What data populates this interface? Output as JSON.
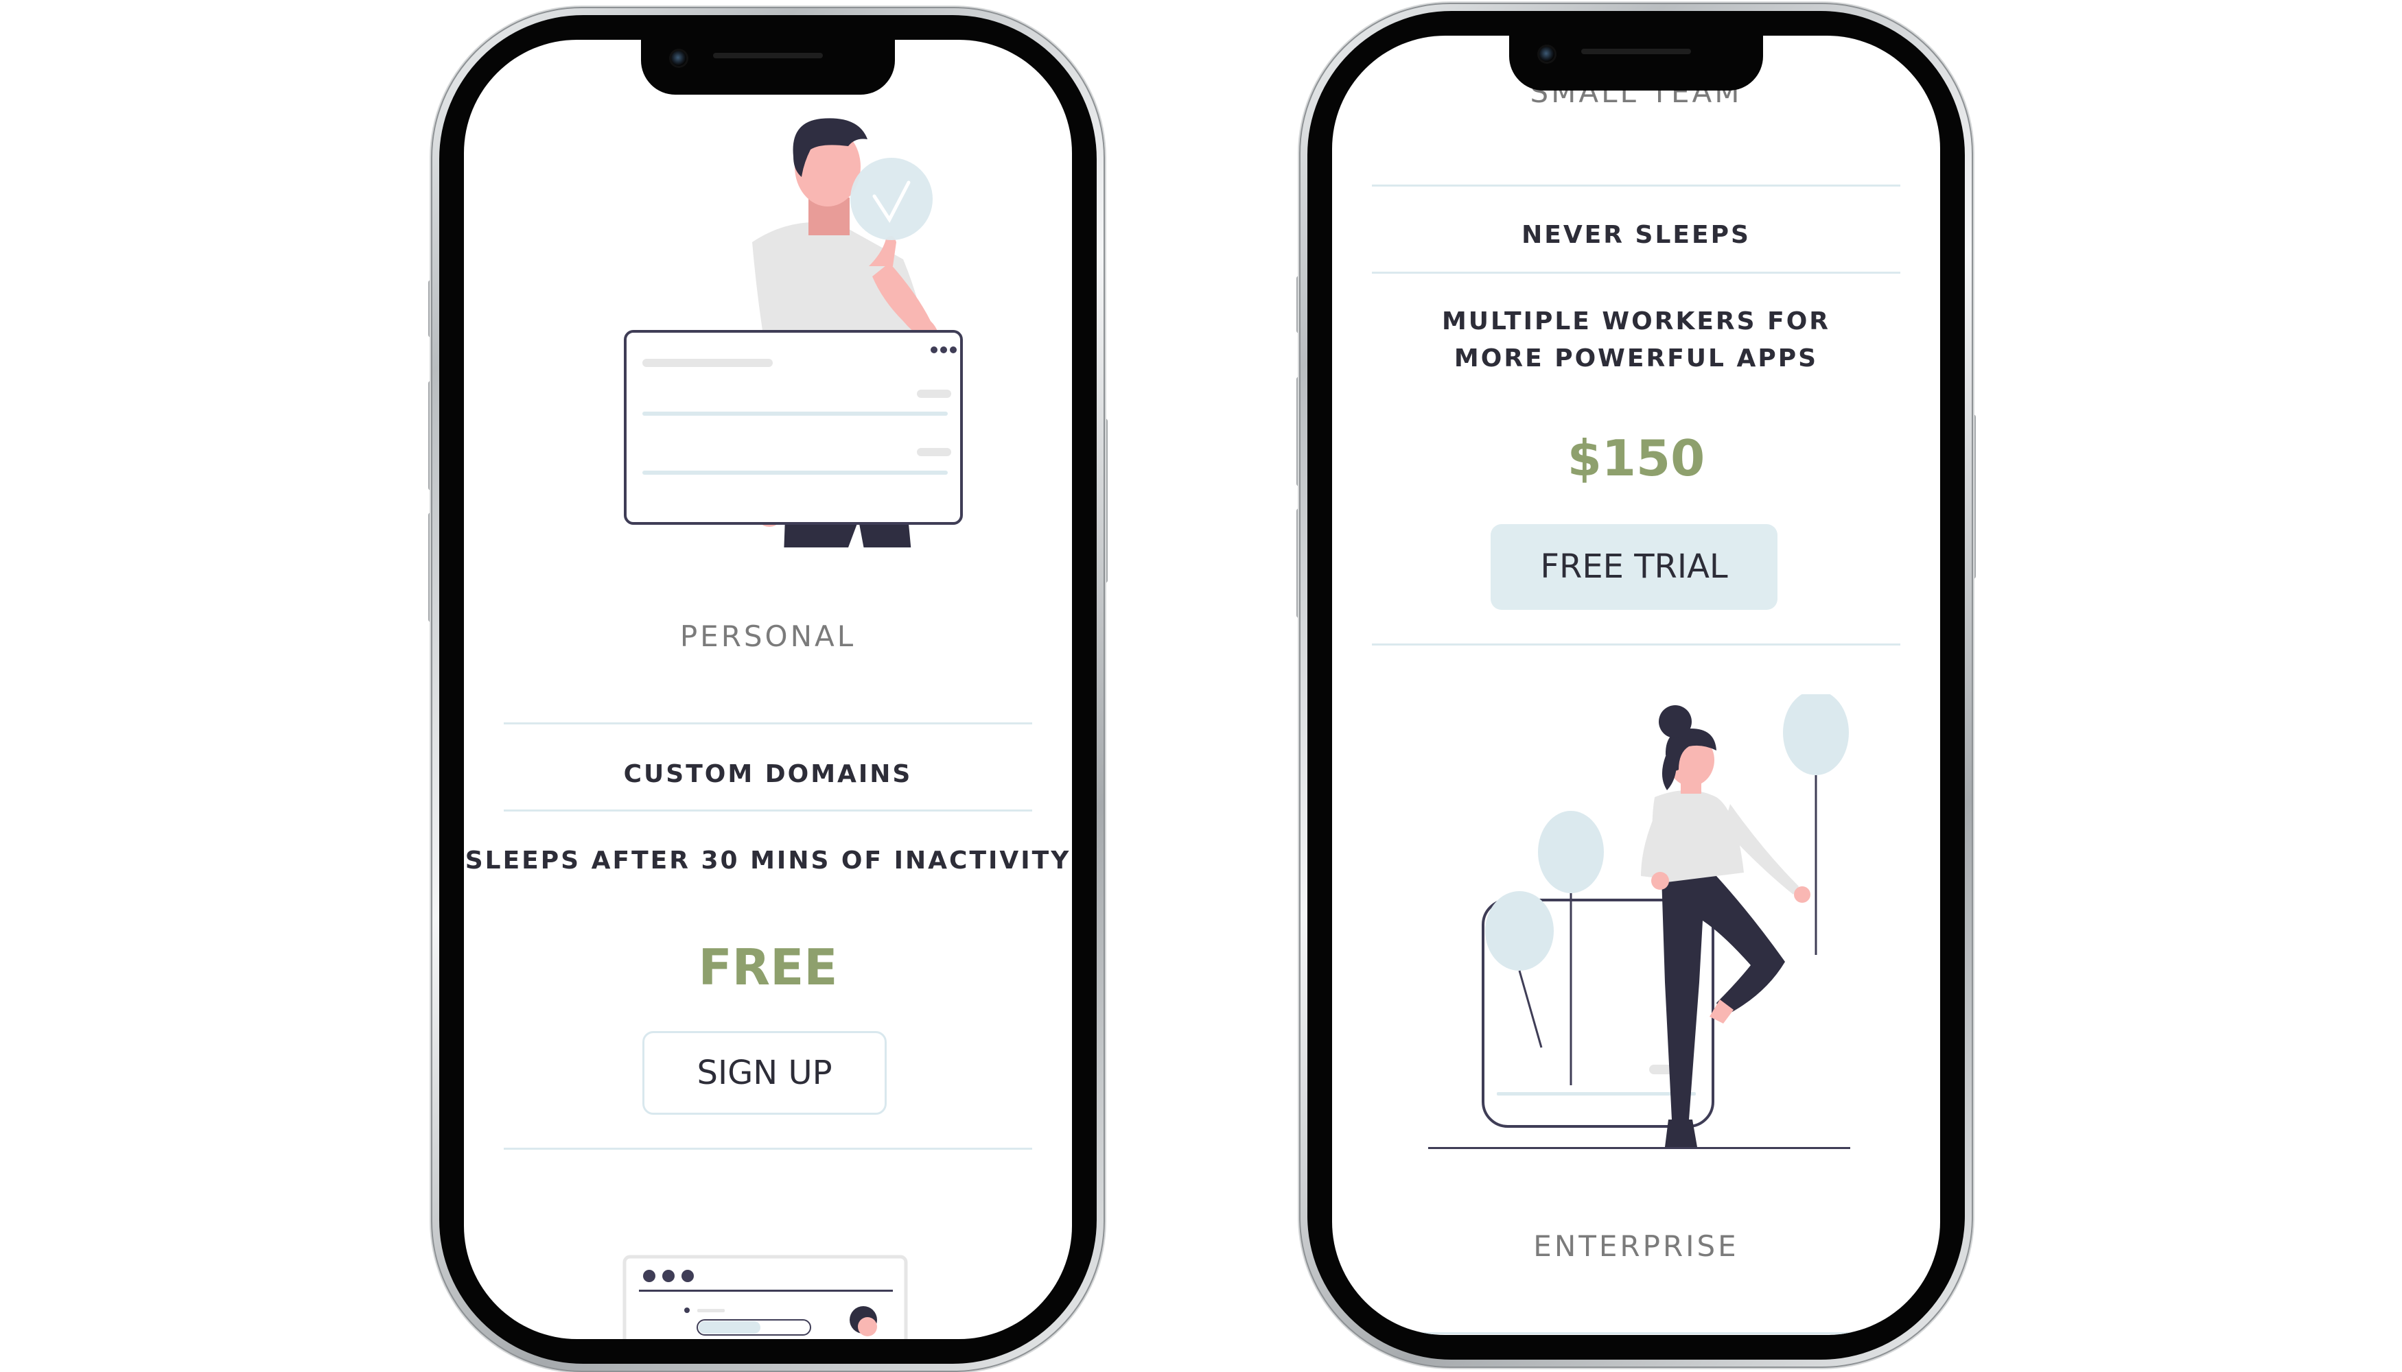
{
  "left_phone": {
    "personal_plan": {
      "title": "PERSONAL",
      "features": [
        "CUSTOM DOMAINS",
        "SLEEPS AFTER 30 MINS OF INACTIVITY"
      ],
      "price": "FREE",
      "button_label": "SIGN UP"
    }
  },
  "right_phone": {
    "small_team_plan": {
      "title": "SMALL TEAM",
      "features": [
        "NEVER SLEEPS",
        "MULTIPLE WORKERS FOR MORE POWERFUL APPS"
      ],
      "price": "$150",
      "button_label": "FREE TRIAL"
    },
    "enterprise_plan": {
      "title": "ENTERPRISE"
    }
  },
  "colors": {
    "price_green": "#8ea06d",
    "divider_blue": "#dbe9ee",
    "button_fill": "#dfecf0",
    "text_dark": "#2d2d38",
    "title_gray": "#7b7b7b",
    "skin": "#f9b7b3",
    "hair_dark": "#2f2e41",
    "balloon": "#dbe9ee"
  },
  "icons": [
    "check-circle-icon",
    "window-dots-icon"
  ]
}
